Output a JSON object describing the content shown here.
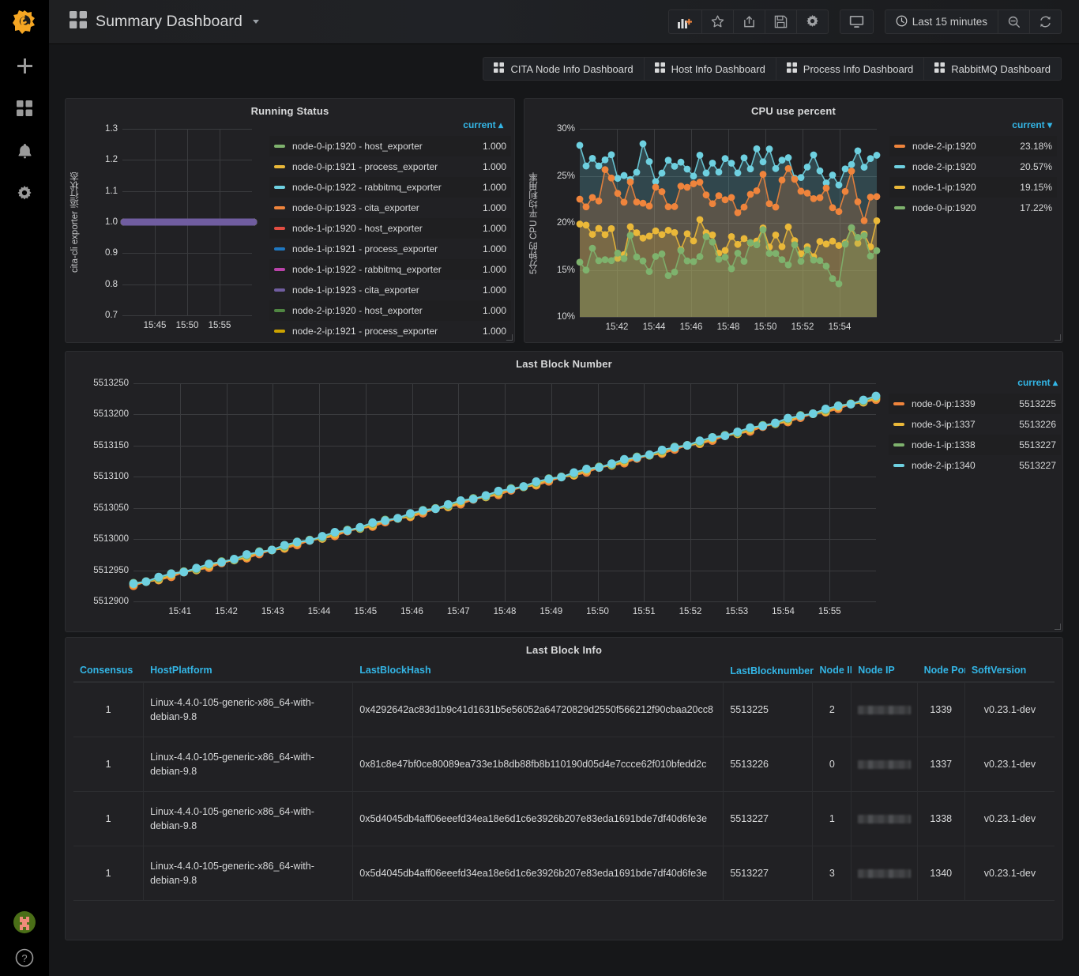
{
  "sidebar": {
    "items": [
      {
        "name": "create-icon",
        "label": "Create"
      },
      {
        "name": "dashboards-icon",
        "label": "Dashboards"
      },
      {
        "name": "alerting-icon",
        "label": "Alerting"
      },
      {
        "name": "configuration-icon",
        "label": "Configuration"
      }
    ],
    "avatar_label": "User",
    "help_label": "?"
  },
  "header": {
    "dashboard_icon": "dashboard-grid-icon",
    "title": "Summary Dashboard",
    "buttons": [
      {
        "name": "add-panel-button",
        "icon": "add-panel-icon"
      },
      {
        "name": "star-button",
        "icon": "star-icon"
      },
      {
        "name": "share-button",
        "icon": "share-icon"
      },
      {
        "name": "save-button",
        "icon": "save-icon"
      },
      {
        "name": "settings-button",
        "icon": "gear-icon"
      },
      {
        "name": "tv-mode-button",
        "icon": "monitor-icon"
      }
    ],
    "time_range": "Last 15 minutes",
    "time_icon": "clock-icon",
    "zoom_out_icon": "zoom-out-icon",
    "refresh_icon": "refresh-icon"
  },
  "dashboard_links": [
    {
      "label": "CITA Node Info Dashboard",
      "icon": "dashboard-grid-icon"
    },
    {
      "label": "Host Info Dashboard",
      "icon": "dashboard-grid-icon"
    },
    {
      "label": "Process Info Dashboard",
      "icon": "dashboard-grid-icon"
    },
    {
      "label": "RabbitMQ Dashboard",
      "icon": "dashboard-grid-icon"
    }
  ],
  "panels": {
    "running": {
      "title": "Running Status"
    },
    "cpu": {
      "title": "CPU use percent"
    },
    "block": {
      "title": "Last Block Number"
    },
    "info": {
      "title": "Last Block Info"
    }
  },
  "chart_data": [
    {
      "id": "running-status",
      "type": "line",
      "title": "Running Status",
      "xlabel": "",
      "ylabel": "cita-cli exporter 运行状态",
      "ylim": [
        0.7,
        1.3
      ],
      "yticks": [
        "0.7",
        "0.8",
        "0.9",
        "1.0",
        "1.1",
        "1.2",
        "1.3"
      ],
      "xticks": [
        "15:45",
        "15:50",
        "15:55"
      ],
      "grid": true,
      "legend_position": "right",
      "legend_header": "current",
      "legend_sort": "asc",
      "series": [
        {
          "name": "node-0-ip:1920 - host_exporter",
          "current": "1.000",
          "color": "#7eb26d",
          "value": 1.0
        },
        {
          "name": "node-0-ip:1921 - process_exporter",
          "current": "1.000",
          "color": "#eab839",
          "value": 1.0
        },
        {
          "name": "node-0-ip:1922 - rabbitmq_exporter",
          "current": "1.000",
          "color": "#6ed0e0",
          "value": 1.0
        },
        {
          "name": "node-0-ip:1923 - cita_exporter",
          "current": "1.000",
          "color": "#ef843c",
          "value": 1.0
        },
        {
          "name": "node-1-ip:1920 - host_exporter",
          "current": "1.000",
          "color": "#e24d42",
          "value": 1.0
        },
        {
          "name": "node-1-ip:1921 - process_exporter",
          "current": "1.000",
          "color": "#1f78c1",
          "value": 1.0
        },
        {
          "name": "node-1-ip:1922 - rabbitmq_exporter",
          "current": "1.000",
          "color": "#ba43a9",
          "value": 1.0
        },
        {
          "name": "node-1-ip:1923 - cita_exporter",
          "current": "1.000",
          "color": "#705da0",
          "value": 1.0
        },
        {
          "name": "node-2-ip:1920 - host_exporter",
          "current": "1.000",
          "color": "#508642",
          "value": 1.0
        },
        {
          "name": "node-2-ip:1921 - process_exporter",
          "current": "1.000",
          "color": "#cca300",
          "value": 1.0
        }
      ]
    },
    {
      "id": "cpu-use-percent",
      "type": "line",
      "title": "CPU use percent",
      "xlabel": "",
      "ylabel": "5分钟的 CPU 平均利用率",
      "ylim": [
        10,
        30
      ],
      "yticks": [
        "10%",
        "15%",
        "20%",
        "25%",
        "30%"
      ],
      "xticks": [
        "15:42",
        "15:44",
        "15:46",
        "15:48",
        "15:50",
        "15:52",
        "15:54"
      ],
      "grid": true,
      "legend_position": "right",
      "legend_header": "current",
      "legend_sort": "desc",
      "series": [
        {
          "name": "node-2-ip:1920",
          "current": "23.18%",
          "color": "#ef843c",
          "values": [
            21.8,
            22.4,
            24.6,
            23.0,
            24.2,
            20.5,
            24.4,
            21.3,
            23.7,
            24.3,
            22.0,
            24.1,
            20.5,
            22.3,
            24.1,
            22.4,
            24.8,
            24.3,
            22.1,
            23.5,
            21.4,
            24.4,
            21.5,
            23.2
          ]
        },
        {
          "name": "node-2-ip:1920",
          "current": "20.57%",
          "color": "#6ed0e0",
          "values": [
            26.8,
            26.7,
            26.6,
            25.5,
            24.8,
            27.3,
            24.6,
            26.9,
            25.8,
            25.7,
            25.9,
            26.4,
            25.7,
            26.8,
            26.7,
            27.4,
            25.8,
            24.8,
            26.8,
            24.7,
            24.8,
            26.5,
            27.0,
            26.9
          ]
        },
        {
          "name": "node-1-ip:1920",
          "current": "19.15%",
          "color": "#eab839",
          "values": [
            19.1,
            19.8,
            19.1,
            16.7,
            19.6,
            17.2,
            20.7,
            17.4,
            18.3,
            18.9,
            19.3,
            16.8,
            18.5,
            18.1,
            18.3,
            18.3,
            18.6,
            17.7,
            16.8,
            18.0,
            18.1,
            18.4,
            18.3,
            19.15
          ]
        },
        {
          "name": "node-0-ip:1920",
          "current": "17.22%",
          "color": "#7eb26d",
          "values": [
            14.4,
            17.1,
            15.4,
            16.7,
            18.6,
            14.1,
            16.8,
            14.4,
            17.0,
            15.2,
            19.0,
            15.7,
            15.3,
            17.6,
            18.4,
            17.2,
            15.8,
            17.0,
            16.8,
            14.6,
            14.3,
            19.0,
            18.2,
            17.22
          ]
        }
      ]
    },
    {
      "id": "last-block-number",
      "type": "line",
      "title": "Last Block Number",
      "xlabel": "",
      "ylabel": "",
      "ylim": [
        5512900,
        5513250
      ],
      "yticks": [
        "5512900",
        "5512950",
        "5513000",
        "5513050",
        "5513100",
        "5513150",
        "5513200",
        "5513250"
      ],
      "xticks": [
        "15:41",
        "15:42",
        "15:43",
        "15:44",
        "15:45",
        "15:46",
        "15:47",
        "15:48",
        "15:49",
        "15:50",
        "15:51",
        "15:52",
        "15:53",
        "15:54",
        "15:55"
      ],
      "grid": true,
      "legend_position": "right",
      "legend_header": "current",
      "legend_sort": "asc",
      "series": [
        {
          "name": "node-0-ip:1339",
          "current": "5513225",
          "color": "#ef843c",
          "start": 5512925,
          "end": 5513225
        },
        {
          "name": "node-3-ip:1337",
          "current": "5513226",
          "color": "#eab839",
          "start": 5512926,
          "end": 5513226
        },
        {
          "name": "node-1-ip:1338",
          "current": "5513227",
          "color": "#7eb26d",
          "start": 5512927,
          "end": 5513227
        },
        {
          "name": "node-2-ip:1340",
          "current": "5513227",
          "color": "#6ed0e0",
          "start": 5512927,
          "end": 5513227
        }
      ]
    }
  ],
  "table": {
    "title": "Last Block Info",
    "sort_column": "LastBlocknumber",
    "sort_direction": "asc",
    "columns": [
      "Consensus",
      "HostPlatform",
      "LastBlockHash",
      "LastBlocknumber",
      "Node ID",
      "Node IP",
      "Node Port",
      "SoftVersion"
    ],
    "rows": [
      {
        "consensus": "1",
        "host_platform": "Linux-4.4.0-105-generic-x86_64-with-debian-9.8",
        "last_block_hash": "0x4292642ac83d1b9c41d1631b5e56052a64720829d2550f566212f90cbaa20cc8",
        "last_block_number": "5513225",
        "node_id": "2",
        "node_ip": "",
        "node_port": "1339",
        "soft_version": "v0.23.1-dev"
      },
      {
        "consensus": "1",
        "host_platform": "Linux-4.4.0-105-generic-x86_64-with-debian-9.8",
        "last_block_hash": "0x81c8e47bf0ce80089ea733e1b8db88fb8b110190d05d4e7ccce62f010bfedd2c",
        "last_block_number": "5513226",
        "node_id": "0",
        "node_ip": "",
        "node_port": "1337",
        "soft_version": "v0.23.1-dev"
      },
      {
        "consensus": "1",
        "host_platform": "Linux-4.4.0-105-generic-x86_64-with-debian-9.8",
        "last_block_hash": "0x5d4045db4aff06eeefd34ea18e6d1c6e3926b207e83eda1691bde7df40d6fe3e",
        "last_block_number": "5513227",
        "node_id": "1",
        "node_ip": "",
        "node_port": "1338",
        "soft_version": "v0.23.1-dev"
      },
      {
        "consensus": "1",
        "host_platform": "Linux-4.4.0-105-generic-x86_64-with-debian-9.8",
        "last_block_hash": "0x5d4045db4aff06eeefd34ea18e6d1c6e3926b207e83eda1691bde7df40d6fe3e",
        "last_block_number": "5513227",
        "node_id": "3",
        "node_ip": "",
        "node_port": "1340",
        "soft_version": "v0.23.1-dev"
      }
    ]
  },
  "colors": {
    "accent": "#33b5e5",
    "panel_bg": "#212124",
    "page_bg": "#161719",
    "text": "#d8d9da"
  }
}
